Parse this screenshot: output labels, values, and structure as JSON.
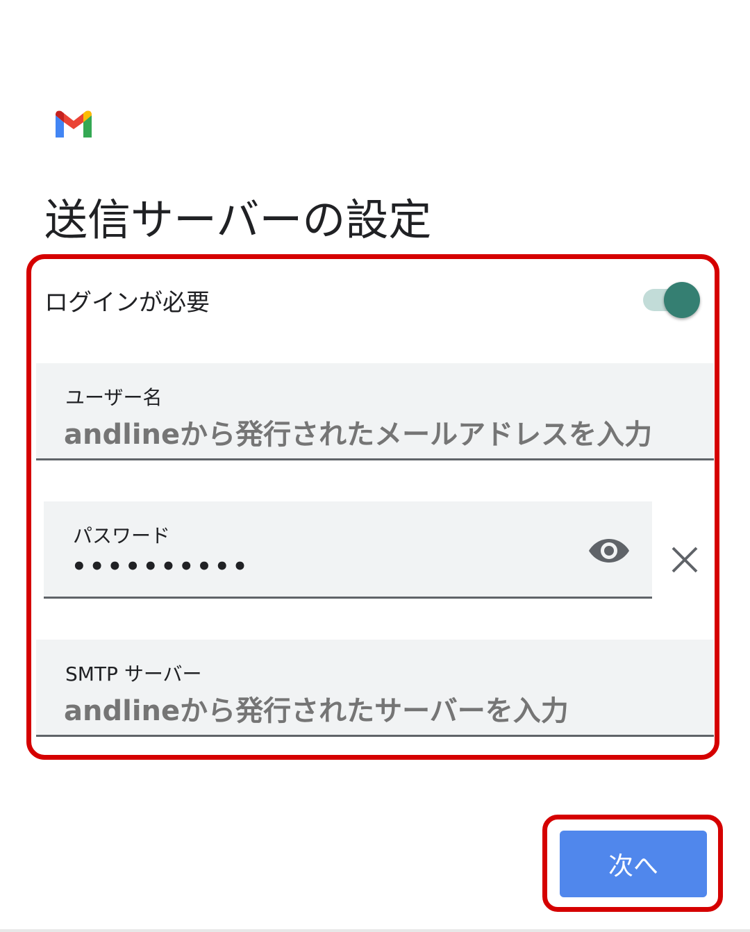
{
  "app": {
    "logo_icon": "gmail-logo"
  },
  "header": {
    "title": "送信サーバーの設定"
  },
  "login": {
    "label": "ログインが必要",
    "toggle_on": true
  },
  "username": {
    "label": "ユーザー名",
    "value": "andlineから発行されたメールアドレスを入力"
  },
  "password": {
    "label": "パスワード",
    "value": "••••••••••",
    "show_icon": "eye-icon",
    "clear_icon": "close-icon"
  },
  "smtp": {
    "label": "SMTP サーバー",
    "value": "andlineから発行されたサーバーを入力"
  },
  "actions": {
    "next_label": "次へ"
  },
  "colors": {
    "accent": "#5087ec",
    "toggle_thumb": "#357f72",
    "toggle_track": "#c2dcd8",
    "highlight": "#d50000",
    "field_bg": "#f1f3f4"
  }
}
